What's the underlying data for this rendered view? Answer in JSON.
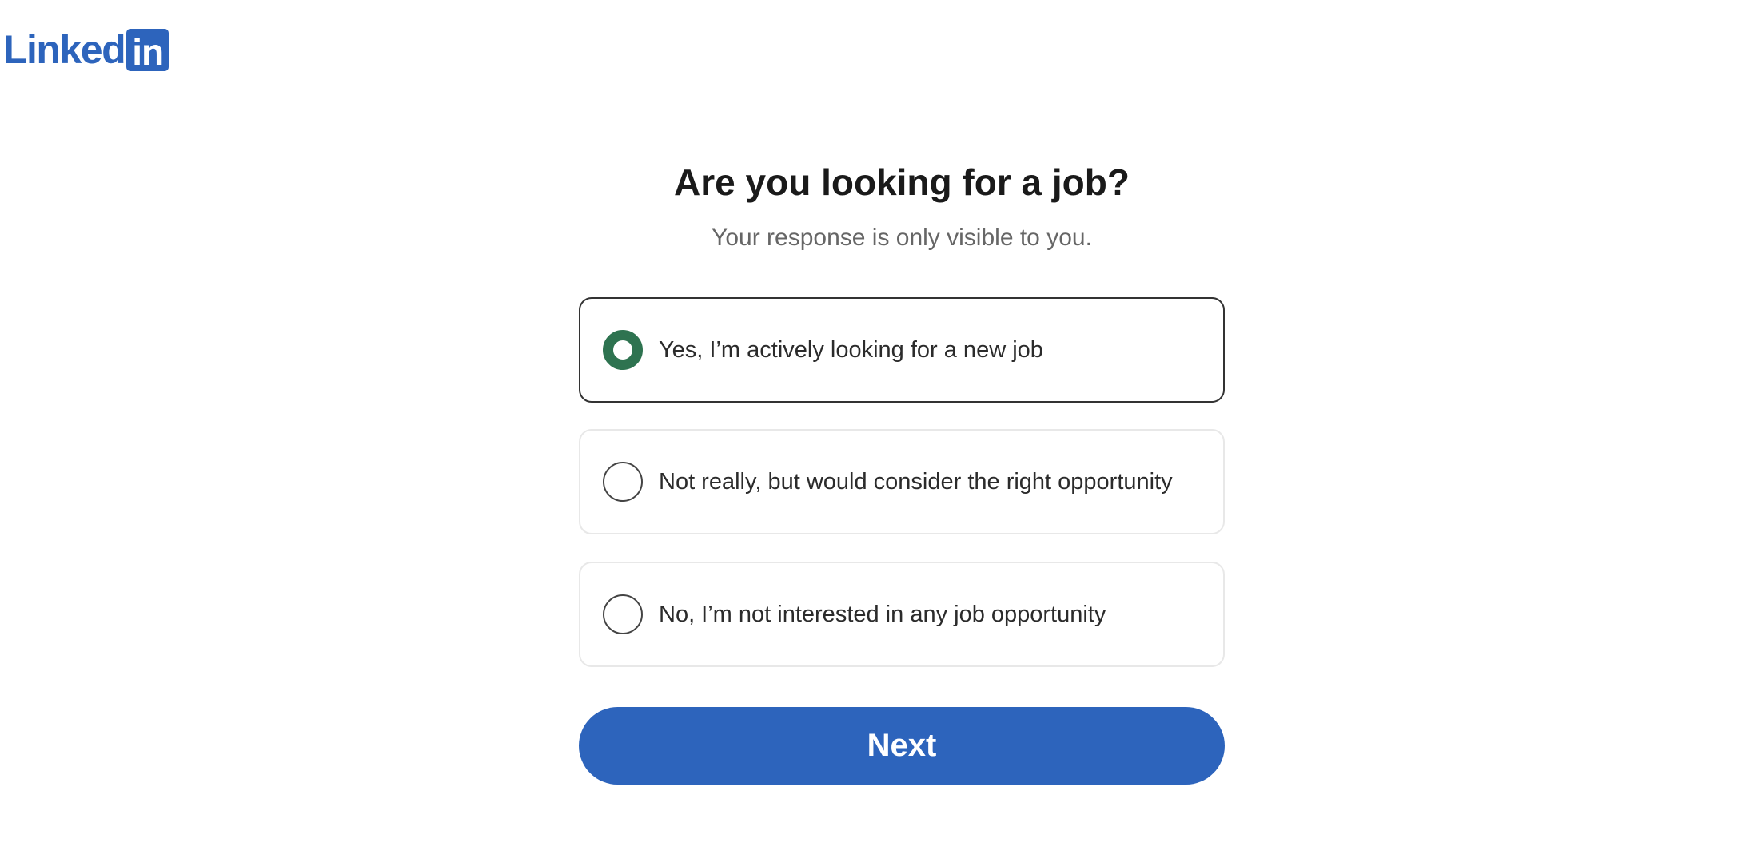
{
  "brand": {
    "wordmark": "Linked",
    "box_text": "in",
    "color": "#2d64bc"
  },
  "question": {
    "title": "Are you looking for a job?",
    "subtitle": "Your response is only visible to you."
  },
  "options": [
    {
      "label": "Yes, I’m actively looking for a new job",
      "selected": true
    },
    {
      "label": "Not really, but would consider the right opportunity",
      "selected": false
    },
    {
      "label": "No, I’m not interested in any job opportunity",
      "selected": false
    }
  ],
  "actions": {
    "next_label": "Next"
  },
  "colors": {
    "accent": "#2d64bc",
    "radio_selected": "#2e7350",
    "title_text": "#1a1a1a",
    "subtitle_text": "#666666"
  }
}
